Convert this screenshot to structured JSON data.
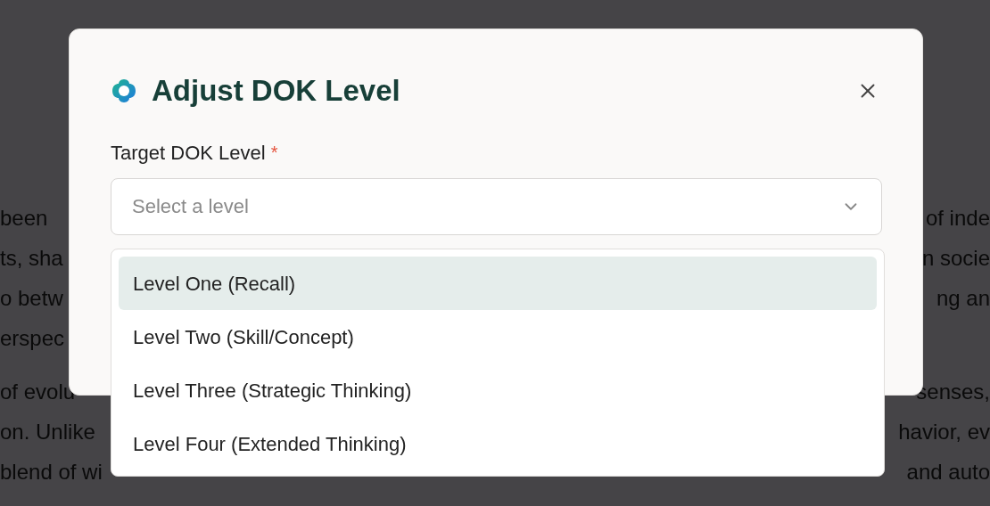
{
  "background": {
    "paragraphs": [
      {
        "lines": [
          {
            "left": "been",
            "right": "of inde"
          },
          {
            "left": "ts, sha",
            "right": "n socie"
          },
          {
            "left": "o betw",
            "right": "ng an"
          },
          {
            "left": "erspec"
          }
        ]
      },
      {
        "lines": [
          {
            "left": "of evolu",
            "right": "senses,"
          },
          {
            "left": "on. Unlike",
            "right": "havior, ev"
          },
          {
            "left": "blend of wi",
            "right": "and auto"
          }
        ]
      }
    ]
  },
  "dialog": {
    "title": "Adjust DOK Level",
    "field": {
      "label": "Target DOK Level",
      "required_mark": "*",
      "placeholder": "Select a level",
      "expanded": true
    },
    "options": [
      {
        "label": "Level One (Recall)",
        "selected": true
      },
      {
        "label": "Level Two (Skill/Concept)",
        "selected": false
      },
      {
        "label": "Level Three (Strategic Thinking)",
        "selected": false
      },
      {
        "label": "Level Four (Extended Thinking)",
        "selected": false
      }
    ]
  }
}
